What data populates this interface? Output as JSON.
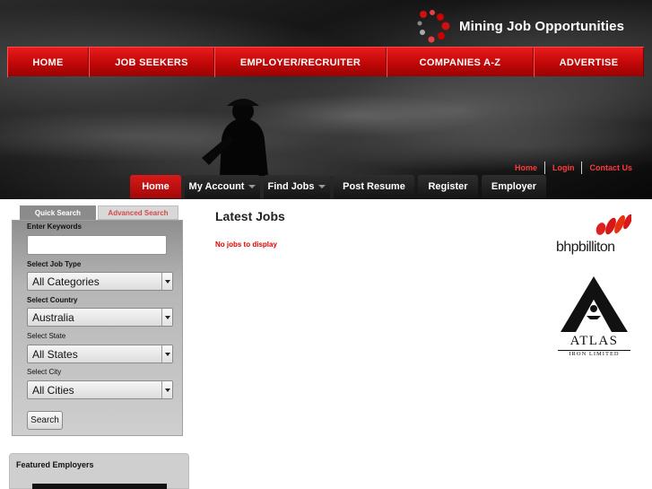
{
  "header": {
    "logo_text": "Mining Job Opportunities",
    "main_nav": [
      "HOME",
      "JOB SEEKERS",
      "EMPLOYER/RECRUITER",
      "COMPANIES A-Z",
      "ADVERTISE"
    ],
    "util_links": [
      "Home",
      "Login",
      "Contact Us"
    ],
    "sub_nav": {
      "home": "Home",
      "my_account": "My Account",
      "find_jobs": "Find Jobs",
      "post_resume": "Post Resume",
      "register": "Register",
      "employer": "Employer"
    }
  },
  "search": {
    "tab_quick": "Quick Search",
    "tab_advanced": "Advanced Search",
    "keywords_label": "Enter Keywords",
    "keywords_value": "",
    "job_type_label": "Select Job Type",
    "job_type_value": "All Categories",
    "country_label": "Select Country",
    "country_value": "Australia",
    "state_label": "Select State",
    "state_value": "All States",
    "city_label": "Select City",
    "city_value": "All Cities",
    "button_label": "Search"
  },
  "featured": {
    "title": "Featured Employers"
  },
  "main": {
    "title": "Latest Jobs",
    "empty_message": "No jobs to display"
  },
  "sponsors": {
    "bhp_text": "bhpbilliton",
    "atlas_text": "ATLAS",
    "atlas_sub": "IRON LIMITED"
  },
  "colors": {
    "accent_red": "#c10707",
    "link_red": "#ff3b3b",
    "dark_tab": "#1f1f1f"
  }
}
